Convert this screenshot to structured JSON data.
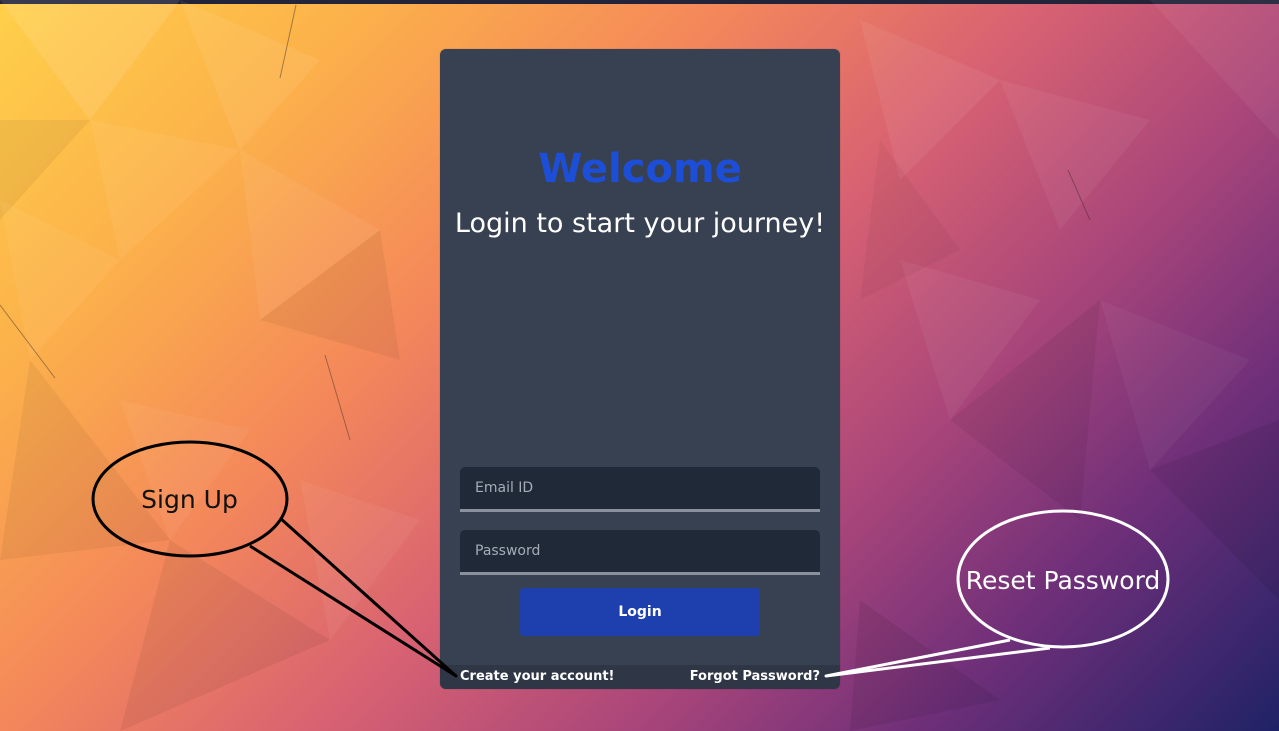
{
  "login_card": {
    "title": "Welcome",
    "subtitle": "Login to start your journey!",
    "email": {
      "placeholder": "Email ID",
      "value": ""
    },
    "password": {
      "placeholder": "Password",
      "value": ""
    },
    "login_button_label": "Login",
    "create_account_link": "Create your account!",
    "forgot_password_link": "Forgot Password?"
  },
  "annotations": {
    "sign_up_label": "Sign Up",
    "reset_password_label": "Reset Password"
  },
  "colors": {
    "card_background": "#384152",
    "title": "#1d4ed8",
    "login_button": "#1e40af",
    "input_background": "#1f2937"
  }
}
